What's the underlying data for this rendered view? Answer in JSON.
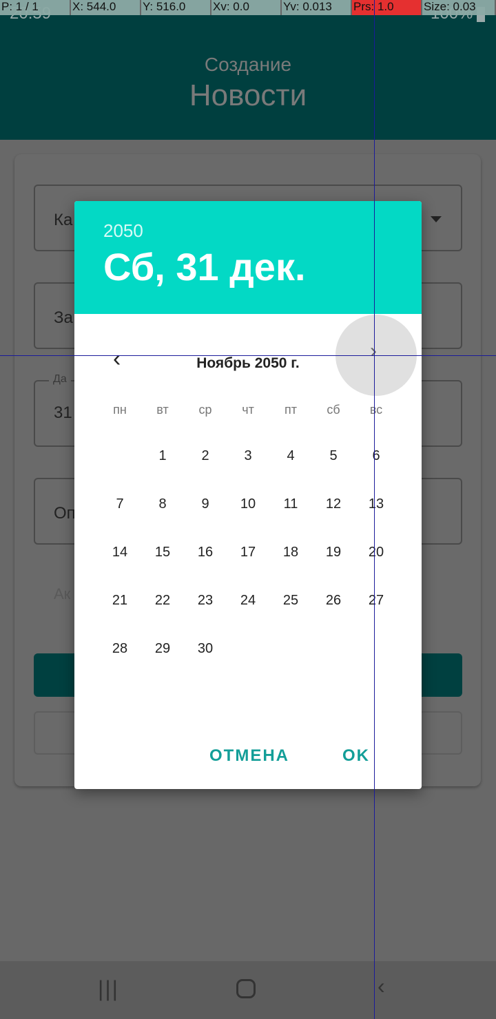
{
  "status_bar": {
    "time": "20:59",
    "battery": "100%"
  },
  "debug_overlay": {
    "pointer": "P: 1 / 1",
    "x": "X: 544.0",
    "y": "Y: 516.0",
    "xv": "Xv: 0.0",
    "yv": "Yv: 0.013",
    "prs": "Prs: 1.0",
    "size": "Size: 0.03",
    "prs_color": "#e53030"
  },
  "header": {
    "subtitle": "Создание",
    "title": "Новости"
  },
  "form": {
    "category_partial": "Ка",
    "title_partial": "За",
    "date_label_partial": "Да",
    "date_value_partial": "31",
    "description_partial": "Оп",
    "active_partial": "Ак"
  },
  "dialog": {
    "year": "2050",
    "selected_date": "Сб, 31 дек.",
    "month_label": "Ноябрь 2050 г.",
    "weekdays": [
      "пн",
      "вт",
      "ср",
      "чт",
      "пт",
      "сб",
      "вс"
    ],
    "first_day_offset": 1,
    "days_in_month": 30,
    "cancel_label": "ОТМЕНА",
    "ok_label": "OK",
    "accent": "#03d9c5"
  }
}
